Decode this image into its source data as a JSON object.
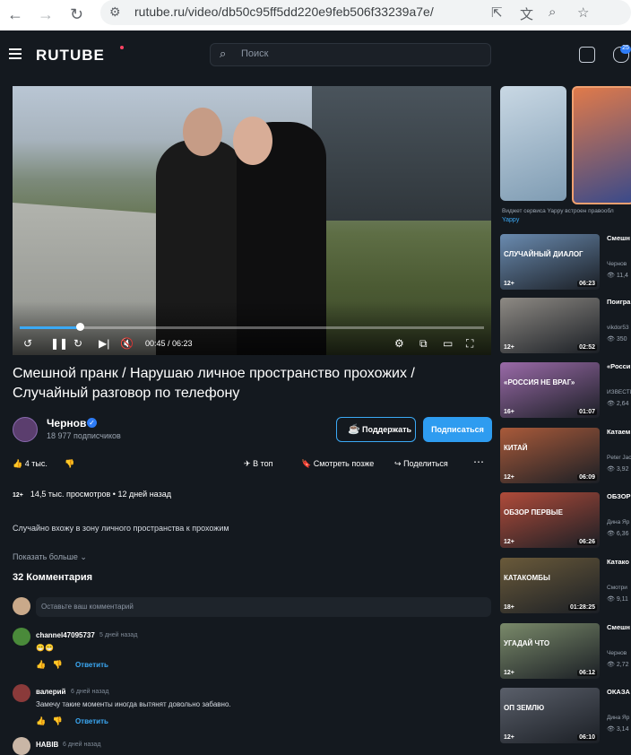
{
  "browser": {
    "url": "rutube.ru/video/db50c95ff5dd220e9feb506f33239a7e/"
  },
  "header": {
    "logo": "RUTUBE",
    "search_placeholder": "Поиск",
    "notif_count": "25"
  },
  "player": {
    "time": "00:45 / 06:23",
    "progress": 0.13,
    "skip_back": "10",
    "skip_fwd": "10"
  },
  "video": {
    "title": "Смешной пранк / Нарушаю личное пространство прохожих / Случайный разговор по телефону",
    "channel": "Чернов",
    "subscribers": "18 977 подписчиков",
    "support_label": "Поддержать",
    "subscribe_label": "Подписаться",
    "likes": "4 тыс.",
    "top_label": "В топ",
    "watch_later_label": "Смотреть позже",
    "share_label": "Поделиться",
    "age": "12+",
    "views": "14,5 тыс. просмотров",
    "posted": "12 дней назад",
    "description": "Случайно вхожу в зону личного пространства к прохожим",
    "show_more": "Показать больше"
  },
  "comments": {
    "count_label": "32 Комментария",
    "input_placeholder": "Оставьте ваш комментарий",
    "reply_label": "Ответить",
    "items": [
      {
        "author": "channel47095737",
        "date": "5 дней назад",
        "text": "😁😁",
        "color": "#4a8a3a"
      },
      {
        "author": "валерий",
        "date": "6 дней назад",
        "text": "Замечу такие моменты иногда вытянят довольно забавно.",
        "color": "#8a3a3a"
      },
      {
        "author": "HABIB",
        "date": "6 дней назад",
        "text": "",
        "color": "#c9b6a6"
      }
    ]
  },
  "sidebar": {
    "promo_caption": "Виджет сервиса Yappy встроен правообл",
    "promo_link": "Yappy",
    "recs": [
      {
        "title": "Смешн Неожи",
        "channel": "Чернов",
        "views": "11,4",
        "age": "12+",
        "duration": "06:23",
        "overlay": "СЛУЧАЙНЫЙ ДИАЛОГ",
        "color": "#6a8bb0"
      },
      {
        "title": "Поигра мышк",
        "channel": "vikdor53",
        "views": "350",
        "age": "12+",
        "duration": "02:52",
        "overlay": "",
        "color": "#8e8a84"
      },
      {
        "title": "«Росси враг»:",
        "channel": "ИЗВЕСТИ",
        "views": "2,64",
        "age": "16+",
        "duration": "01:07",
        "overlay": "«РОССИЯ НЕ ВРАГ»",
        "color": "#9a6aa8"
      },
      {
        "title": "Катаем Китайс",
        "channel": "Peter Jac",
        "views": "3,92",
        "age": "12+",
        "duration": "06:09",
        "overlay": "КИТАЙ",
        "color": "#a95a3a"
      },
      {
        "title": "ОБЗОР РЕАЛИ",
        "channel": "Дина Яр",
        "views": "6,36",
        "age": "12+",
        "duration": "06:26",
        "overlay": "ОБЗОР ПЕРВЫЕ",
        "color": "#b04b3a"
      },
      {
        "title": "Катако Catacol",
        "channel": "Смотри",
        "views": "9,11",
        "age": "18+",
        "duration": "01:28:25",
        "overlay": "КАТАКОМБЫ",
        "color": "#6a5a3a"
      },
      {
        "title": "Смешн Неловк",
        "channel": "Чернов",
        "views": "2,72",
        "age": "12+",
        "duration": "06:12",
        "overlay": "УГАДАЙ ЧТО",
        "color": "#7a8a6a"
      },
      {
        "title": "ОКАЗА глубин",
        "channel": "Дина Яр",
        "views": "3,14",
        "age": "12+",
        "duration": "06:10",
        "overlay": "ОП ЗЕМЛЮ",
        "color": "#5a5f6a"
      }
    ]
  }
}
